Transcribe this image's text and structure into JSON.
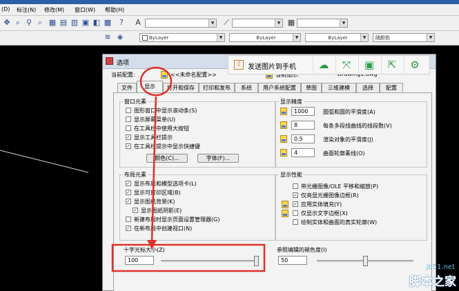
{
  "menubar": {
    "items": [
      "(D)",
      "标注(N)",
      "修改(M)",
      "窗口(W)",
      "帮助(H)"
    ]
  },
  "toolbar": {
    "layer_combo": "ByLayer",
    "linetype_combo": "ByLayer",
    "lineweight_combo": "ByLayer",
    "color_combo": "随颜色"
  },
  "share_bar": {
    "send_label": "发送图片到手机"
  },
  "dialog": {
    "title": "选项",
    "current_profile_label": "当前配置:",
    "current_profile_value": "<<未命名配置>>",
    "current_drawing_label": "当前图形:",
    "current_drawing_value": "Drawing1.dwg",
    "tabs": [
      "文件",
      "显示",
      "打开和保存",
      "打印和发布",
      "系统",
      "用户系统配置",
      "草图",
      "三维建模",
      "选择",
      "配置"
    ],
    "window_elements": {
      "title": "窗口元素",
      "options": [
        {
          "label": "图形窗口中显示滚动条(S)",
          "checked": false
        },
        {
          "label": "显示屏幕菜单(U)",
          "checked": false
        },
        {
          "label": "在工具栏中使用大按钮",
          "checked": false
        },
        {
          "label": "显示工具栏提示",
          "checked": true
        },
        {
          "label": "在工具栏提示中显示快捷键",
          "checked": true
        }
      ],
      "colors_button": "颜色(C)...",
      "fonts_button": "字体(F)..."
    },
    "display_resolution": {
      "title": "显示精度",
      "items": [
        {
          "value": "1000",
          "label": "圆弧和圆的平滑度(A)"
        },
        {
          "value": "8",
          "label": "每条多段线曲线的线段数(V)"
        },
        {
          "value": "0.5",
          "label": "渲染对象的平滑度(J)"
        },
        {
          "value": "4",
          "label": "曲面轮廓素线(O)"
        }
      ]
    },
    "layout_elements": {
      "title": "布局元素",
      "options": [
        {
          "label": "显示布局和模型选项卡(L)",
          "checked": true
        },
        {
          "label": "显示可打印区域(B)",
          "checked": true
        },
        {
          "label": "显示图纸背景(K)",
          "checked": true
        },
        {
          "label": "显示图纸阴影(E)",
          "checked": true
        },
        {
          "label": "新建布局时显示页面设置管理器(G)",
          "checked": false
        },
        {
          "label": "在新布局中创建视口(N)",
          "checked": true
        }
      ]
    },
    "display_performance": {
      "title": "显示性能",
      "options": [
        {
          "label": "带光栅图像/OLE 平移和缩放(P)",
          "checked": false
        },
        {
          "label": "仅亮显光栅图像边框(R)",
          "checked": true
        },
        {
          "label": "应用实体填充(Y)",
          "checked": true
        },
        {
          "label": "仅显示文字边框(X)",
          "checked": false
        },
        {
          "label": "绘制实体和曲面的真实轮廓(W)",
          "checked": false
        }
      ]
    },
    "crosshair": {
      "title": "十字光标大小(Z)",
      "value": "100",
      "slider_fraction": 1.0
    },
    "xref_fading": {
      "title": "参照编辑的褪色度(I)",
      "value": "50",
      "slider_fraction": 0.5
    }
  },
  "watermark": {
    "domain": "jb51.net",
    "name": "脚本之家"
  },
  "colors": {
    "highlight": "#e0312b",
    "accent_green": "#2e9a4a"
  }
}
